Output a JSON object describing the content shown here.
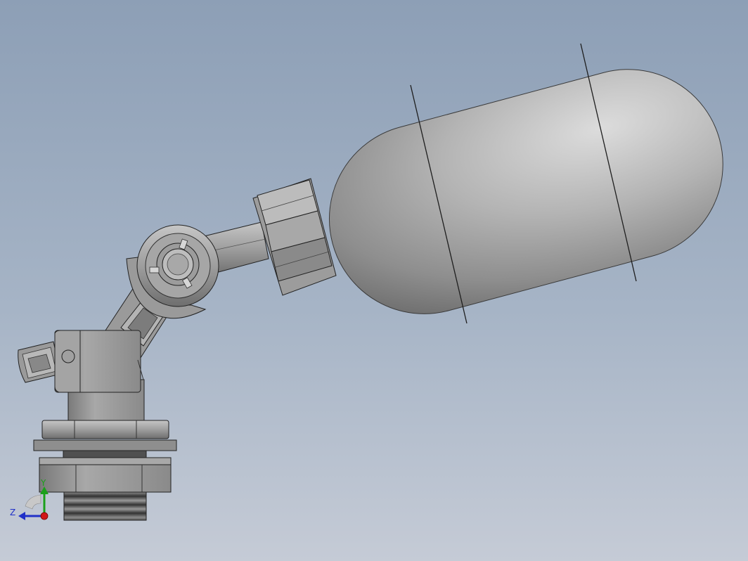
{
  "viewport": {
    "background_top": "#8d9fb6",
    "background_bottom": "#c5cbd6"
  },
  "model": {
    "part_color": "#9a9a9a",
    "edge_color": "#1e1e1e"
  },
  "triad": {
    "y_label": "Y",
    "z_label": "Z",
    "y_color": "#1aa01a",
    "z_color": "#2030c8",
    "x_color": "#d01818"
  }
}
